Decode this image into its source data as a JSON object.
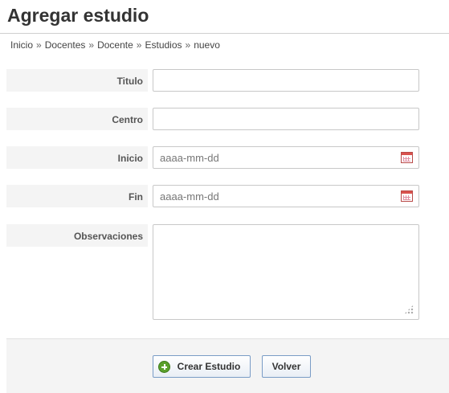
{
  "header": {
    "title": "Agregar estudio"
  },
  "breadcrumb": {
    "items": [
      "Inicio",
      "Docentes",
      "Docente",
      "Estudios",
      "nuevo"
    ],
    "separator": "»"
  },
  "form": {
    "fields": {
      "titulo": {
        "label": "Titulo",
        "value": "",
        "placeholder": ""
      },
      "centro": {
        "label": "Centro",
        "value": "",
        "placeholder": ""
      },
      "inicio": {
        "label": "Inicio",
        "value": "",
        "placeholder": "aaaa-mm-dd",
        "icon": "calendar-icon"
      },
      "fin": {
        "label": "Fin",
        "value": "",
        "placeholder": "aaaa-mm-dd",
        "icon": "calendar-icon"
      },
      "observaciones": {
        "label": "Observaciones",
        "value": "",
        "placeholder": ""
      }
    }
  },
  "actions": {
    "create_label": "Crear Estudio",
    "create_icon": "plus-circle-icon",
    "back_label": "Volver"
  },
  "colors": {
    "create_icon_green": "#5aa02c",
    "button_border": "#7a9cc6",
    "calendar_red": "#d9534f"
  }
}
